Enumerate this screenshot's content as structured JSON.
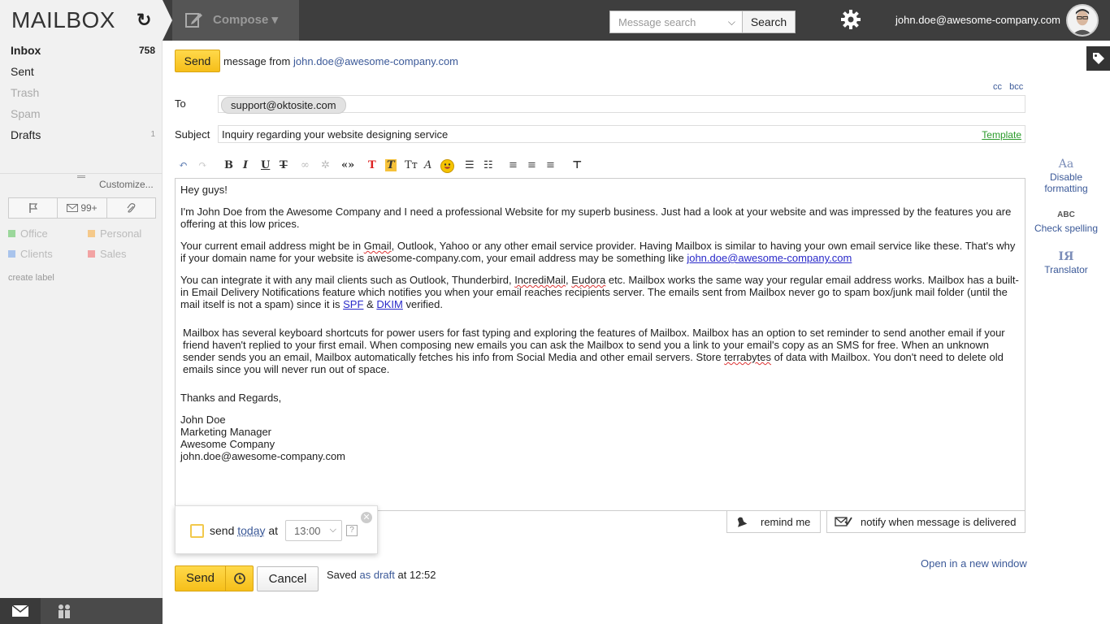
{
  "header": {
    "logo": "MAILBOX",
    "compose_label": "Compose ▾",
    "search_placeholder": "Message search",
    "search_button": "Search",
    "user_email": "john.doe@awesome-company.com"
  },
  "sidebar": {
    "folders": [
      {
        "label": "Inbox",
        "count": "758"
      },
      {
        "label": "Sent",
        "count": ""
      },
      {
        "label": "Trash",
        "count": ""
      },
      {
        "label": "Spam",
        "count": ""
      },
      {
        "label": "Drafts",
        "count": "1"
      }
    ],
    "customize": "Customize...",
    "filter_unread": "99+",
    "labels": [
      {
        "name": "Office",
        "color": "#9bd79b"
      },
      {
        "name": "Personal",
        "color": "#f5c98a"
      },
      {
        "name": "Clients",
        "color": "#a9c4ec"
      },
      {
        "name": "Sales",
        "color": "#f2a3a3"
      }
    ],
    "create_label": "create label"
  },
  "compose": {
    "send_label": "Send",
    "message_from_prefix": "message from",
    "from_email": "john.doe@awesome-company.com",
    "cc": "cc",
    "bcc": "bcc",
    "to_label": "To",
    "to_recipient": "support@oktosite.com",
    "subject_label": "Subject",
    "subject_value": "Inquiry regarding your website designing service",
    "template_link": "Template"
  },
  "body": {
    "greeting": "Hey guys!",
    "p1": "I'm John Doe from the Awesome Company and I need a professional Website for my superb business. Just had a look at your website and was impressed by the features you are offering at this low prices.",
    "p2_a": "Your current email address might be in",
    "p2_gmail": "Gmail",
    "p2_b": ", Outlook, Yahoo or any other email service provider. Having Mailbox is similar to having your own email service like these. That's why if your domain name for your website is awesome-company.com, your email address may be something like",
    "p2_link": "john.doe@awesome-company.com",
    "p3_a": "You can integrate it with any mail clients such as Outlook, Thunderbird,",
    "p3_incredimail": "IncrediMail",
    "p3_comma": ",",
    "p3_eudora": "Eudora",
    "p3_b": "etc. Mailbox works the same way your regular email address works. Mailbox has a built-in Email Delivery Notifications feature which notifies you when your email reaches recipients server. The emails sent from Mailbox never go to spam box/junk mail folder (until the mail itself is not a spam) since it is",
    "p3_spf": "SPF",
    "p3_amp": "&",
    "p3_dkim": "DKIM",
    "p3_c": "verified.",
    "p4_a": "Mailbox has several keyboard shortcuts for power users for fast typing and exploring the features of Mailbox. Mailbox has an option to set reminder to send another email if your friend haven't replied to your first email. When composing new emails you can ask the Mailbox to send you a link to your email's copy as an SMS for free. When an unknown sender sends you an email, Mailbox automatically fetches his info from Social Media and other email servers. Store",
    "p4_terrabytes": "terrabytes",
    "p4_b": "of data with Mailbox. You don't need to delete old emails since you will never run out of space.",
    "closing": "Thanks and Regards,",
    "sig_name": "John Doe",
    "sig_title": "Marketing Manager",
    "sig_company": "Awesome Company",
    "sig_email": "john.doe@awesome-company.com"
  },
  "footer": {
    "remind_me": "remind me",
    "notify": "notify when message is delivered",
    "send_later_prefix": "send",
    "send_later_day": "today",
    "send_later_at": "at",
    "send_later_time": "13:00",
    "help": "?",
    "open_new_window": "Open in a new window",
    "send_label": "Send",
    "cancel_label": "Cancel",
    "saved_prefix": "Saved",
    "saved_link": "as draft",
    "saved_suffix": "at 12:52"
  },
  "right_panel": {
    "disable_formatting_icon": "Aa",
    "disable_formatting": "Disable formatting",
    "check_spelling_icon": "ABC",
    "check_spelling": "Check spelling",
    "translator_icon": "IЯ",
    "translator": "Translator"
  }
}
